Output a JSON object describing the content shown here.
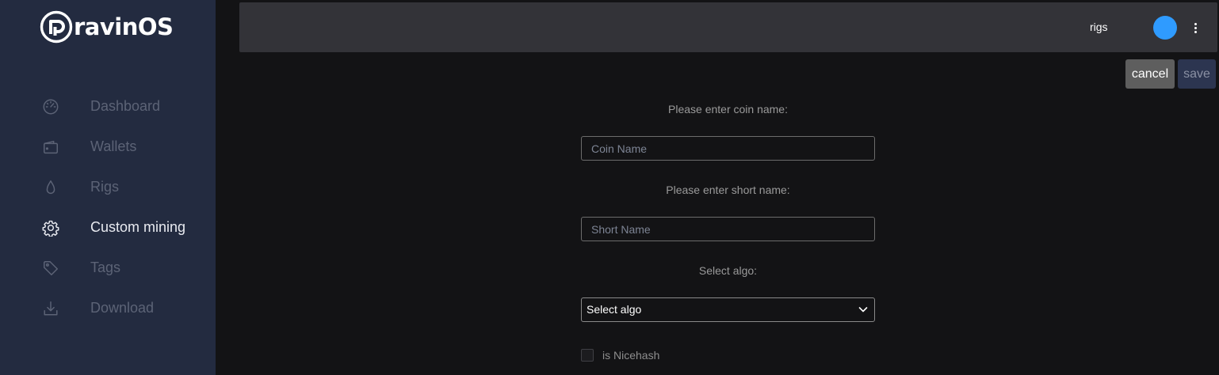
{
  "brand": {
    "logo_text": "ravinOS",
    "logo_letter": "r"
  },
  "sidebar": {
    "items": [
      {
        "label": "Dashboard",
        "icon": "speedometer-icon",
        "active": false
      },
      {
        "label": "Wallets",
        "icon": "wallet-icon",
        "active": false
      },
      {
        "label": "Rigs",
        "icon": "drop-icon",
        "active": false
      },
      {
        "label": "Custom mining",
        "icon": "gear-icon",
        "active": true
      },
      {
        "label": "Tags",
        "icon": "tag-icon",
        "active": false
      },
      {
        "label": "Download",
        "icon": "download-icon",
        "active": false
      }
    ]
  },
  "header": {
    "rigs_label": "rigs",
    "avatar_color": "#2f9bff",
    "more_icon": "more-vertical-icon"
  },
  "actions": {
    "cancel_label": "cancel",
    "save_label": "save"
  },
  "form": {
    "coin_name_prompt": "Please enter coin name:",
    "coin_name_placeholder": "Coin Name",
    "coin_name_value": "",
    "short_name_prompt": "Please enter short name:",
    "short_name_placeholder": "Short Name",
    "short_name_value": "",
    "algo_prompt": "Select algo:",
    "algo_selected": "Select algo",
    "nicehash_label": "is Nicehash",
    "nicehash_checked": false
  },
  "colors": {
    "sidebar_bg": "#232b40",
    "page_bg": "#131315",
    "topbar_bg": "#333338",
    "accent": "#2f9bff",
    "save_bg": "#2c3550",
    "cancel_bg": "#5e5e5e"
  }
}
